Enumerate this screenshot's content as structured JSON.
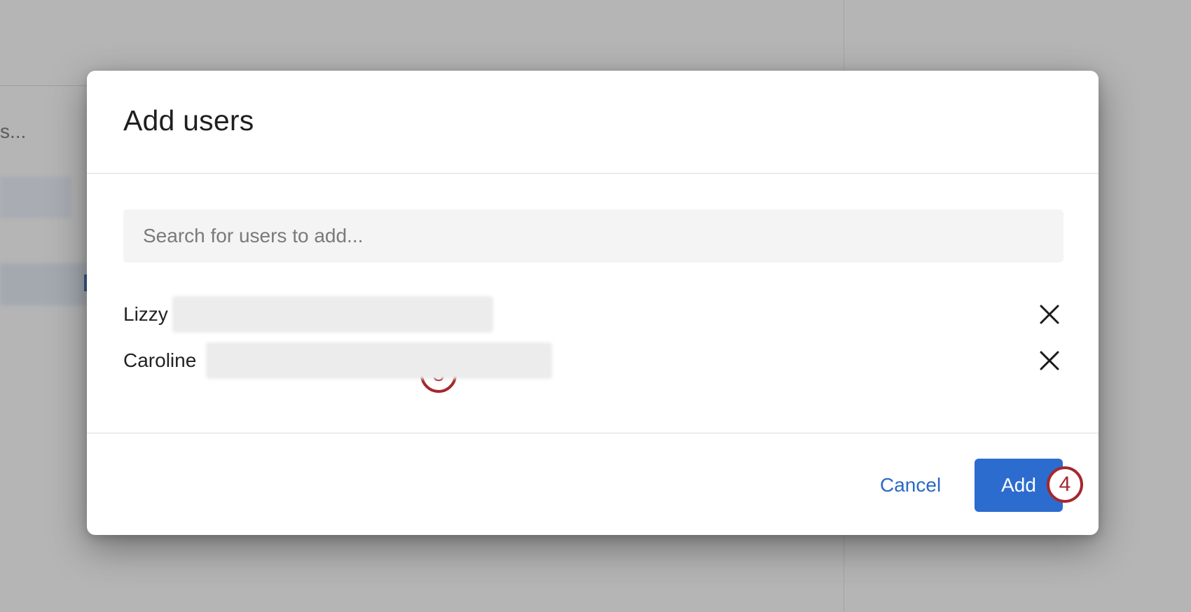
{
  "background": {
    "truncated_text": "s..."
  },
  "dialog": {
    "title": "Add users",
    "search": {
      "placeholder": "Search for users to add...",
      "value": "",
      "callout": "3"
    },
    "users": [
      {
        "name": "Lizzy",
        "remove_icon": "close-icon"
      },
      {
        "name": "Caroline",
        "remove_icon": "close-icon"
      }
    ],
    "footer": {
      "cancel_label": "Cancel",
      "add_label": "Add",
      "add_callout": "4"
    }
  },
  "colors": {
    "primary": "#2c6ccf",
    "link": "#2a69c6",
    "callout": "#a4282e",
    "overlay": "#b5b5b5"
  }
}
